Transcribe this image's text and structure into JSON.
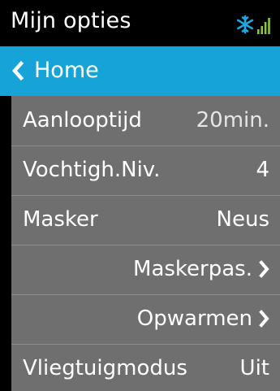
{
  "header": {
    "title": "Mijn opties",
    "icons": [
      "snowflake-icon",
      "signal-strength-icon"
    ],
    "snowflake_color": "#1aa9e0",
    "signal_color": "#8bc53f"
  },
  "nav": {
    "back_label": "Home",
    "back_icon": "chevron-left-icon",
    "bar_color": "#16a4d8"
  },
  "menu": {
    "items": [
      {
        "label": "Aanlooptijd",
        "value": "20min."
      },
      {
        "label": "Vochtigh.Niv.",
        "value": "4"
      },
      {
        "label": "Masker",
        "value": "Neus"
      },
      {
        "label": "Maskerpas.",
        "icon": "chevron-right-icon"
      },
      {
        "label": "Opwarmen",
        "icon": "chevron-right-icon"
      },
      {
        "label": "Vliegtuigmodus",
        "value": "Uit"
      }
    ]
  }
}
